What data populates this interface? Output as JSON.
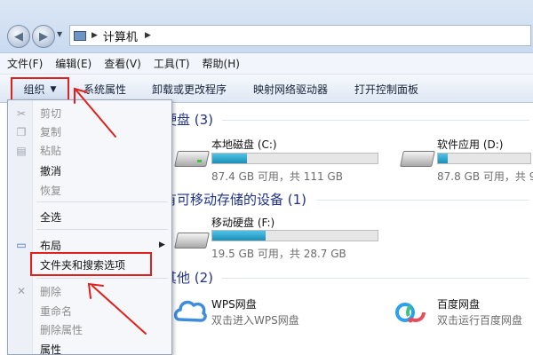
{
  "window": {
    "breadcrumb": [
      "计算机"
    ]
  },
  "menubar": {
    "items": [
      "文件(F)",
      "编辑(E)",
      "查看(V)",
      "工具(T)",
      "帮助(H)"
    ]
  },
  "commandbar": {
    "organize": "组织",
    "items": [
      "系统属性",
      "卸载或更改程序",
      "映射网络驱动器",
      "打开控制面板"
    ]
  },
  "popup": {
    "items": [
      {
        "label": "剪切",
        "enabled": false,
        "icon": "scissors-icon"
      },
      {
        "label": "复制",
        "enabled": false,
        "icon": "copy-icon"
      },
      {
        "label": "粘贴",
        "enabled": false,
        "icon": "paste-icon"
      },
      {
        "label": "撤消",
        "enabled": true
      },
      {
        "label": "恢复",
        "enabled": false
      },
      {
        "label": "全选",
        "enabled": true
      },
      {
        "label": "布局",
        "enabled": true,
        "icon": "layout-icon",
        "submenu": true
      },
      {
        "label": "文件夹和搜索选项",
        "enabled": true,
        "highlighted": true
      },
      {
        "label": "删除",
        "enabled": false,
        "icon": "delete-icon"
      },
      {
        "label": "重命名",
        "enabled": false
      },
      {
        "label": "删除属性",
        "enabled": false
      },
      {
        "label": "属性",
        "enabled": true
      }
    ]
  },
  "content": {
    "sections": [
      {
        "title": "硬盘 (3)"
      },
      {
        "title": "有可移动存储的设备 (1)"
      },
      {
        "title": "其他 (2)"
      }
    ],
    "drives": [
      {
        "name": "本地磁盘 (C:)",
        "info": "87.4 GB 可用，共 111 GB",
        "used_fraction": 0.21
      },
      {
        "name": "软件应用 (D:)",
        "info": "87.8 GB 可用，共 9",
        "used_fraction": 0.11
      },
      {
        "name": "移动硬盘 (F:)",
        "info": "19.5 GB 可用，共 28.7 GB",
        "used_fraction": 0.32
      }
    ],
    "others": [
      {
        "name": "WPS网盘",
        "desc": "双击进入WPS网盘"
      },
      {
        "name": "百度网盘",
        "desc": "双击运行百度网盘"
      }
    ]
  },
  "colors": {
    "highlight_border": "#e0201c",
    "section_title": "#1e3287",
    "bar_fill": "#26a0da"
  }
}
